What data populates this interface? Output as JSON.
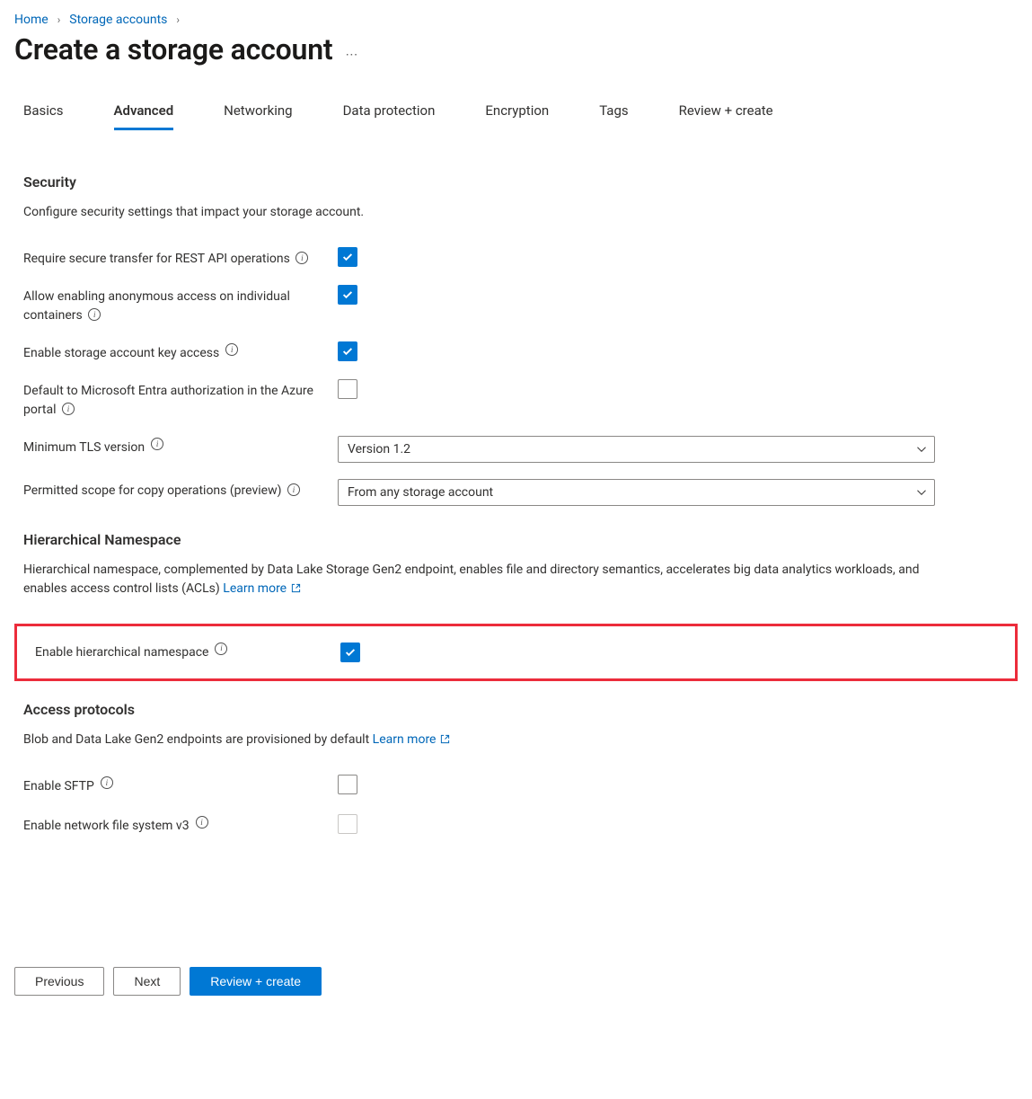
{
  "breadcrumb": {
    "items": [
      {
        "label": "Home"
      },
      {
        "label": "Storage accounts"
      }
    ]
  },
  "title": "Create a storage account",
  "tabs": [
    {
      "label": "Basics",
      "active": false
    },
    {
      "label": "Advanced",
      "active": true
    },
    {
      "label": "Networking",
      "active": false
    },
    {
      "label": "Data protection",
      "active": false
    },
    {
      "label": "Encryption",
      "active": false
    },
    {
      "label": "Tags",
      "active": false
    },
    {
      "label": "Review + create",
      "active": false
    }
  ],
  "sections": {
    "security": {
      "heading": "Security",
      "desc": "Configure security settings that impact your storage account.",
      "fields": {
        "secure_transfer": {
          "label": "Require secure transfer for REST API operations",
          "checked": true
        },
        "anon_access": {
          "label": "Allow enabling anonymous access on individual containers",
          "checked": true
        },
        "key_access": {
          "label": "Enable storage account key access",
          "checked": true
        },
        "entra_default": {
          "label": "Default to Microsoft Entra authorization in the Azure portal",
          "checked": false
        },
        "tls": {
          "label": "Minimum TLS version",
          "value": "Version 1.2"
        },
        "copy_scope": {
          "label": "Permitted scope for copy operations (preview)",
          "value": "From any storage account"
        }
      }
    },
    "hns": {
      "heading": "Hierarchical Namespace",
      "desc": "Hierarchical namespace, complemented by Data Lake Storage Gen2 endpoint, enables file and directory semantics, accelerates big data analytics workloads, and enables access control lists (ACLs)",
      "learn_more": "Learn more",
      "field": {
        "label": "Enable hierarchical namespace",
        "checked": true
      }
    },
    "access": {
      "heading": "Access protocols",
      "desc": "Blob and Data Lake Gen2 endpoints are provisioned by default",
      "learn_more": "Learn more",
      "fields": {
        "sftp": {
          "label": "Enable SFTP",
          "checked": false,
          "disabled": false
        },
        "nfs": {
          "label": "Enable network file system v3",
          "checked": false,
          "disabled": true
        }
      }
    }
  },
  "footer": {
    "previous": "Previous",
    "next": "Next",
    "review": "Review + create"
  }
}
